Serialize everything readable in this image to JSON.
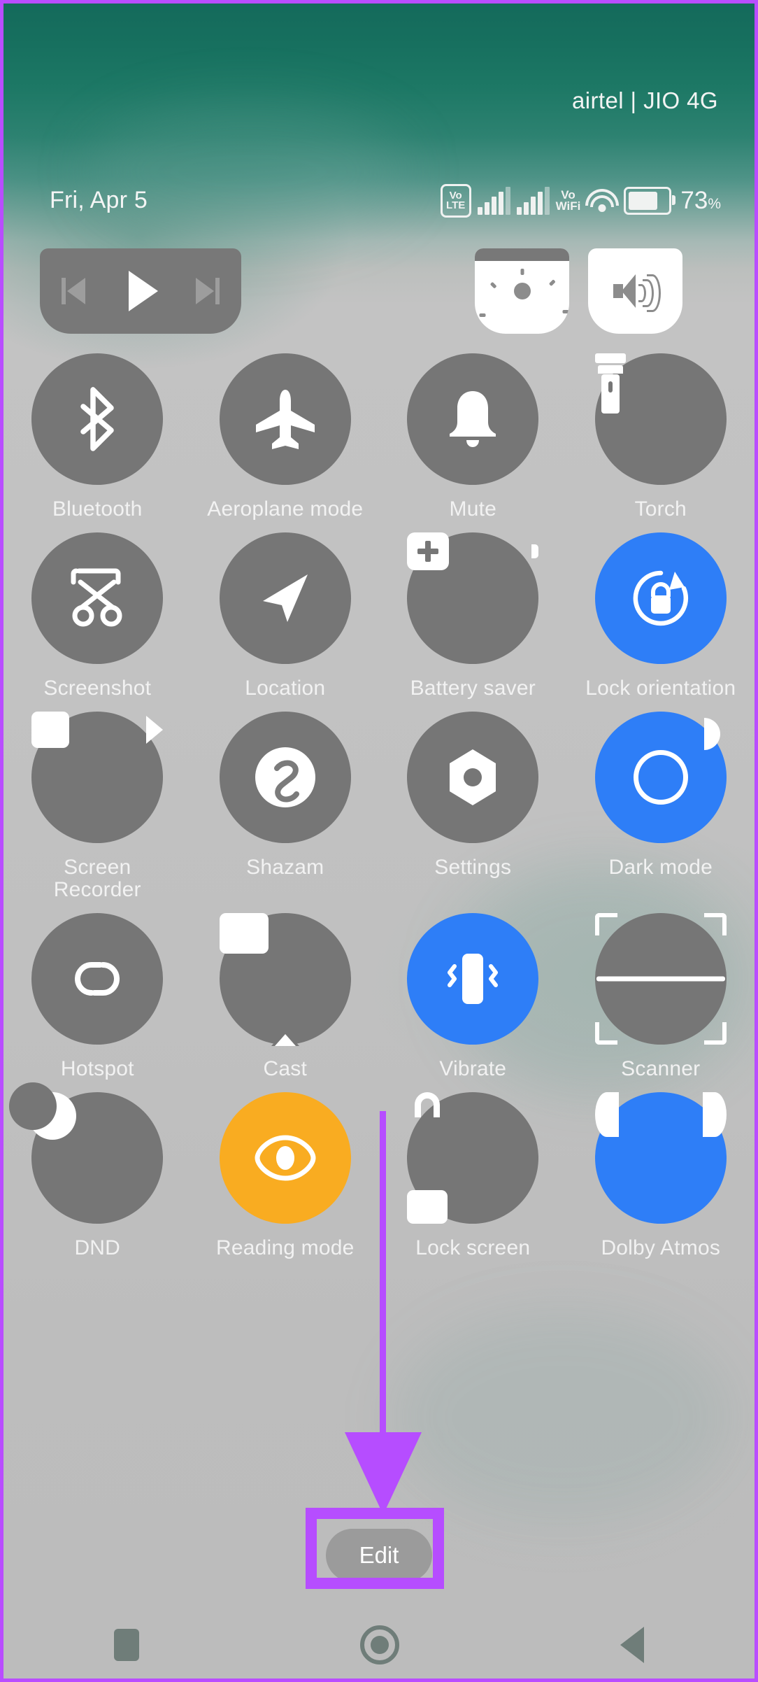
{
  "status_bar": {
    "carrier": "airtel | JIO 4G",
    "date": "Fri, Apr 5",
    "volte_top": "Vo",
    "volte_bottom": "LTE",
    "vowifi_top": "Vo",
    "vowifi_bottom": "WiFi",
    "battery_percent": "73",
    "battery_percent_symbol": "%",
    "signal_bars_filled": 4,
    "signal_bars_total": 5,
    "wifi_level": "full"
  },
  "media_controls": {
    "previous_label": "previous-track",
    "play_label": "play",
    "next_label": "next-track"
  },
  "sliders": [
    {
      "name": "brightness",
      "icon": "sun-icon",
      "level": 14
    },
    {
      "name": "volume",
      "icon": "speaker-icon",
      "level": 0
    }
  ],
  "tiles": [
    [
      {
        "label": "Bluetooth",
        "icon": "bluetooth-icon",
        "state": "off"
      },
      {
        "label": "Aeroplane mode",
        "icon": "aeroplane-icon",
        "state": "off"
      },
      {
        "label": "Mute",
        "icon": "bell-icon",
        "state": "off"
      },
      {
        "label": "Torch",
        "icon": "torch-icon",
        "state": "off"
      }
    ],
    [
      {
        "label": "Screenshot",
        "icon": "scissors-icon",
        "state": "off"
      },
      {
        "label": "Location",
        "icon": "navigation-arrow-icon",
        "state": "off"
      },
      {
        "label": "Battery saver",
        "icon": "battery-plus-icon",
        "state": "off"
      },
      {
        "label": "Lock orientation",
        "icon": "rotation-lock-icon",
        "state": "on"
      }
    ],
    [
      {
        "label": "Screen Recorder",
        "icon": "video-camera-icon",
        "state": "off"
      },
      {
        "label": "Shazam",
        "icon": "shazam-icon",
        "state": "off"
      },
      {
        "label": "Settings",
        "icon": "gear-icon",
        "state": "off"
      },
      {
        "label": "Dark mode",
        "icon": "contrast-icon",
        "state": "on"
      }
    ],
    [
      {
        "label": "Hotspot",
        "icon": "link-icon",
        "state": "off"
      },
      {
        "label": "Cast",
        "icon": "cast-icon",
        "state": "off"
      },
      {
        "label": "Vibrate",
        "icon": "vibrate-icon",
        "state": "on"
      },
      {
        "label": "Scanner",
        "icon": "scan-frame-icon",
        "state": "off"
      }
    ],
    [
      {
        "label": "DND",
        "icon": "moon-icon",
        "state": "off"
      },
      {
        "label": "Reading mode",
        "icon": "eye-icon",
        "state": "amber"
      },
      {
        "label": "Lock screen",
        "icon": "padlock-icon",
        "state": "off"
      },
      {
        "label": "Dolby Atmos",
        "icon": "dolby-icon",
        "state": "on"
      }
    ]
  ],
  "edit_button": {
    "label": "Edit"
  },
  "nav_bar": {
    "recents_label": "recents-square",
    "home_label": "home-circle",
    "back_label": "back-triangle"
  },
  "annotation": {
    "type": "arrow-and-highlight-box",
    "color": "#b64dff",
    "points_to": "Edit"
  },
  "colors": {
    "tile_off": "#767676",
    "tile_on": "#2e7ef7",
    "tile_amber": "#f9ac21",
    "wallpaper_top": "#146a5b",
    "wallpaper_bottom": "#bcbcbc",
    "annotation": "#b64dff",
    "edit_button": "#9b9b9b"
  }
}
